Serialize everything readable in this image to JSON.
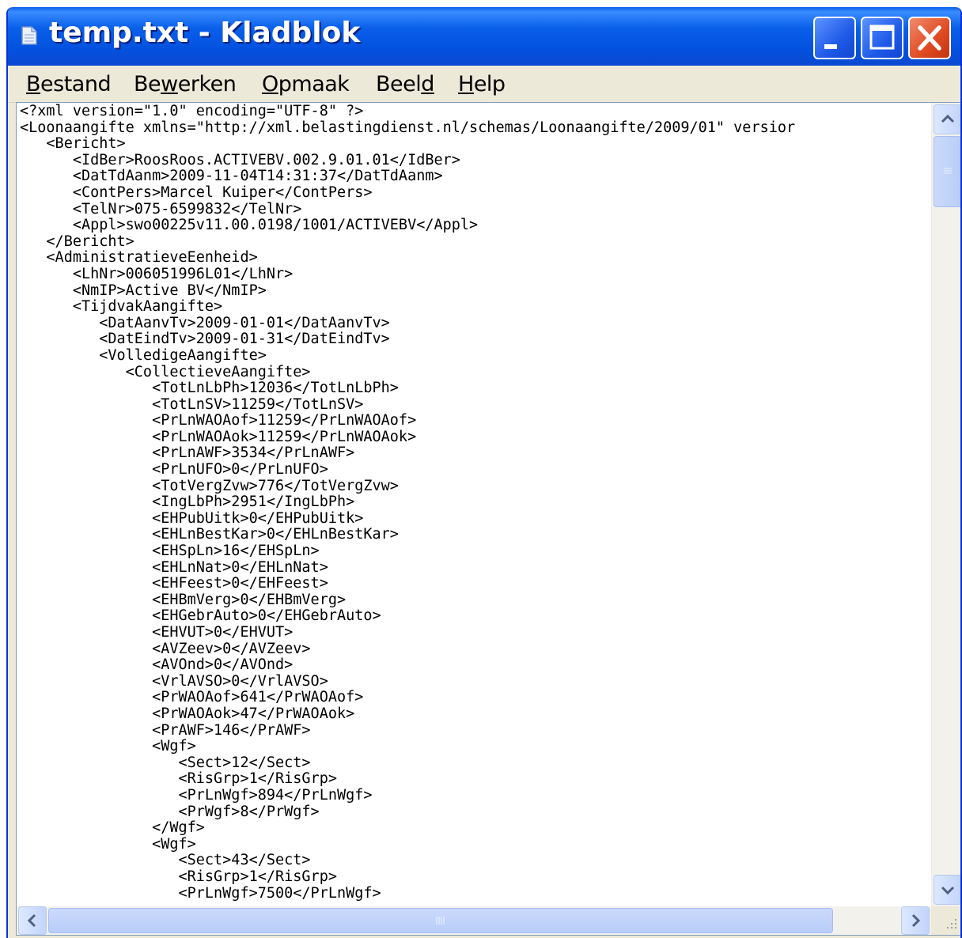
{
  "window": {
    "title": "temp.txt - Kladblok",
    "accent": "#0A5FE8",
    "close_color": "#E04A22"
  },
  "menu": {
    "items": [
      {
        "pre": "",
        "key": "B",
        "post": "estand"
      },
      {
        "pre": "Be",
        "key": "w",
        "post": "erken"
      },
      {
        "pre": "",
        "key": "O",
        "post": "pmaak"
      },
      {
        "pre": "Beel",
        "key": "d",
        "post": ""
      },
      {
        "pre": "",
        "key": "H",
        "post": "elp"
      }
    ]
  },
  "icons": {
    "app": "notepad-icon",
    "minimize": "minimize-icon",
    "maximize": "maximize-icon",
    "close": "close-icon",
    "scroll_up": "chevron-up-icon",
    "scroll_down": "chevron-down-icon",
    "scroll_left": "chevron-left-icon",
    "scroll_right": "chevron-right-icon",
    "resize": "resize-grip-icon"
  },
  "document": {
    "lines": [
      "<?xml version=\"1.0\" encoding=\"UTF-8\" ?>",
      "<Loonaangifte xmlns=\"http://xml.belastingdienst.nl/schemas/Loonaangifte/2009/01\" versior",
      "   <Bericht>",
      "      <IdBer>RoosRoos.ACTIVEBV.002.9.01.01</IdBer>",
      "      <DatTdAanm>2009-11-04T14:31:37</DatTdAanm>",
      "      <ContPers>Marcel Kuiper</ContPers>",
      "      <TelNr>075-6599832</TelNr>",
      "      <Appl>swo00225v11.00.0198/1001/ACTIVEBV</Appl>",
      "   </Bericht>",
      "   <AdministratieveEenheid>",
      "      <LhNr>006051996L01</LhNr>",
      "      <NmIP>Active BV</NmIP>",
      "      <TijdvakAangifte>",
      "         <DatAanvTv>2009-01-01</DatAanvTv>",
      "         <DatEindTv>2009-01-31</DatEindTv>",
      "         <VolledigeAangifte>",
      "            <CollectieveAangifte>",
      "               <TotLnLbPh>12036</TotLnLbPh>",
      "               <TotLnSV>11259</TotLnSV>",
      "               <PrLnWAOAof>11259</PrLnWAOAof>",
      "               <PrLnWAOAok>11259</PrLnWAOAok>",
      "               <PrLnAWF>3534</PrLnAWF>",
      "               <PrLnUFO>0</PrLnUFO>",
      "               <TotVergZvw>776</TotVergZvw>",
      "               <IngLbPh>2951</IngLbPh>",
      "               <EHPubUitk>0</EHPubUitk>",
      "               <EHLnBestKar>0</EHLnBestKar>",
      "               <EHSpLn>16</EHSpLn>",
      "               <EHLnNat>0</EHLnNat>",
      "               <EHFeest>0</EHFeest>",
      "               <EHBmVerg>0</EHBmVerg>",
      "               <EHGebrAuto>0</EHGebrAuto>",
      "               <EHVUT>0</EHVUT>",
      "               <AVZeev>0</AVZeev>",
      "               <AVOnd>0</AVOnd>",
      "               <VrlAVSO>0</VrlAVSO>",
      "               <PrWAOAof>641</PrWAOAof>",
      "               <PrWAOAok>47</PrWAOAok>",
      "               <PrAWF>146</PrAWF>",
      "               <Wgf>",
      "                  <Sect>12</Sect>",
      "                  <RisGrp>1</RisGrp>",
      "                  <PrLnWgf>894</PrLnWgf>",
      "                  <PrWgf>8</PrWgf>",
      "               </Wgf>",
      "               <Wgf>",
      "                  <Sect>43</Sect>",
      "                  <RisGrp>1</RisGrp>",
      "                  <PrLnWgf>7500</PrLnWgf>"
    ]
  }
}
